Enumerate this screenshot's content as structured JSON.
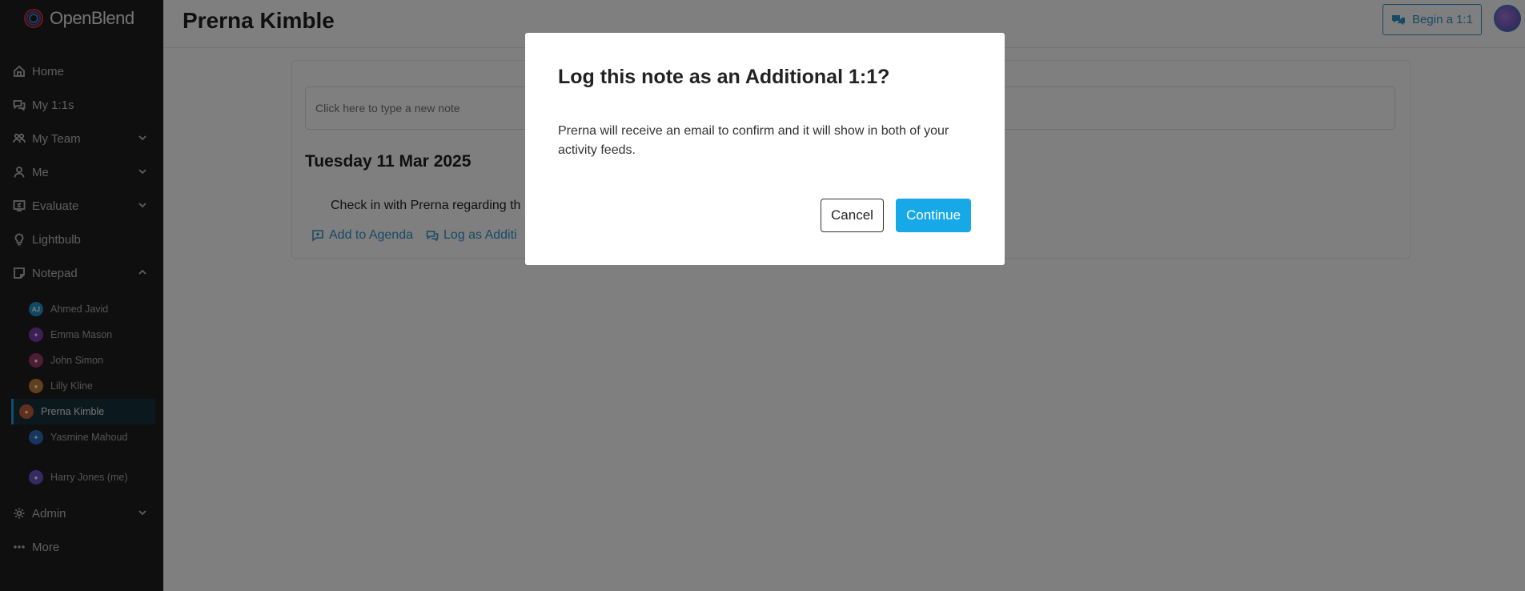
{
  "app": {
    "name": "OpenBlend"
  },
  "sidebar": {
    "nav": [
      {
        "label": "Home",
        "icon": "home-icon"
      },
      {
        "label": "My 1:1s",
        "icon": "chat-icon"
      },
      {
        "label": "My Team",
        "icon": "team-icon",
        "expandable": true
      },
      {
        "label": "Me",
        "icon": "user-icon",
        "expandable": true
      },
      {
        "label": "Evaluate",
        "icon": "evaluate-icon",
        "expandable": true
      },
      {
        "label": "Lightbulb",
        "icon": "lightbulb-icon"
      },
      {
        "label": "Notepad",
        "icon": "notepad-icon",
        "expanded": true
      }
    ],
    "notepad_people": [
      {
        "name": "Ahmed Javid",
        "initials": "AJ",
        "color": "#1e93c9"
      },
      {
        "name": "Emma Mason",
        "initials": "",
        "color": "#7a3fb0"
      },
      {
        "name": "John Simon",
        "initials": "",
        "color": "#9a3b6a"
      },
      {
        "name": "Lilly Kline",
        "initials": "",
        "color": "#c87f3a"
      },
      {
        "name": "Prerna Kimble",
        "initials": "",
        "color": "#c45d3a",
        "active": true
      },
      {
        "name": "Yasmine Mahoud",
        "initials": "",
        "color": "#2a6fbf"
      }
    ],
    "me_person": {
      "name": "Harry Jones (me)",
      "color": "#6a55c2"
    },
    "bottom_nav": [
      {
        "label": "Admin",
        "icon": "gear-icon",
        "expandable": true
      },
      {
        "label": "More",
        "icon": "more-icon"
      }
    ]
  },
  "header": {
    "title": "Prerna Kimble",
    "begin_button": "Begin a 1:1"
  },
  "main": {
    "note_placeholder": "Click here to type a new note",
    "date_heading": "Tuesday 11 Mar 2025",
    "note_text": "Check in with Prerna regarding th",
    "actions": {
      "add_to_agenda": "Add to Agenda",
      "log_additional": "Log as Additi"
    }
  },
  "modal": {
    "title": "Log this note as an Additional 1:1?",
    "body": "Prerna will receive an email to confirm and it will show in both of your activity feeds.",
    "cancel": "Cancel",
    "continue": "Continue"
  },
  "colors": {
    "accent": "#17a8e8",
    "link": "#2f95c8",
    "sidebar_bg": "#1f1f1f"
  }
}
